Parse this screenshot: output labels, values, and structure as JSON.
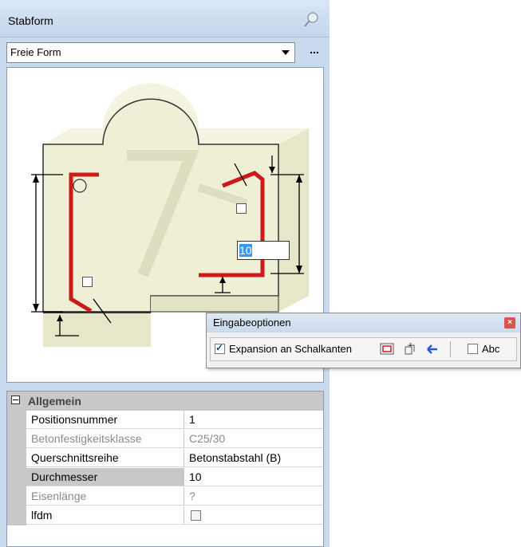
{
  "panel": {
    "title": "Stabform",
    "shape_select": "Freie Form",
    "more_button": "...",
    "diameter_input": "10"
  },
  "properties": {
    "category": "Allgemein",
    "rows": [
      {
        "name": "Positionsnummer",
        "value": "1",
        "disabled": false
      },
      {
        "name": "Betonfestigkeitsklasse",
        "value": "C25/30",
        "disabled": true
      },
      {
        "name": "Querschnittsreihe",
        "value": "Betonstabstahl (B)",
        "disabled": false
      },
      {
        "name": "Durchmesser",
        "value": "10",
        "disabled": false,
        "selected": true
      },
      {
        "name": "Eisenlänge",
        "value": "?",
        "disabled": true
      },
      {
        "name": "lfdm",
        "value": "",
        "checkbox": true,
        "checked": false
      }
    ]
  },
  "eingabeoptionen": {
    "title": "Eingabeoptionen",
    "expansion_label": "Expansion an Schalkanten",
    "expansion_checked": true,
    "abc_label": "Abc",
    "abc_checked": false,
    "icons": [
      "formwork-edge-icon",
      "dimension-icon",
      "arrow-left-icon"
    ]
  },
  "colors": {
    "panel_bg": "#c9daee",
    "concrete": "#efefd6",
    "rebar": "#cc1a1a",
    "selection": "#3399ff"
  }
}
